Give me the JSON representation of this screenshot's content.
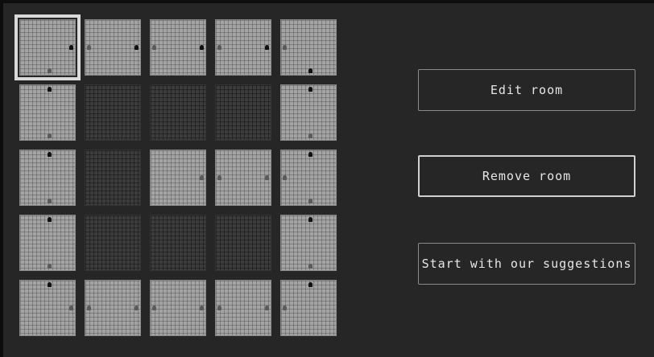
{
  "colors": {
    "background": "#262626",
    "room_floor": "#a3a3a3",
    "room_empty": "#3c3c3c",
    "selection": "#d9d9d9",
    "button_border": "#8a8a8a",
    "button_text": "#e6e6e6"
  },
  "map": {
    "rows": 5,
    "cols": 5,
    "selected": "0,0",
    "rooms": [
      [
        {
          "filled": true,
          "doors": {
            "bottom": "grey",
            "right": "dark"
          }
        },
        {
          "filled": true,
          "doors": {
            "left": "grey",
            "right": "dark"
          }
        },
        {
          "filled": true,
          "doors": {
            "left": "grey",
            "right": "dark"
          }
        },
        {
          "filled": true,
          "doors": {
            "left": "grey",
            "right": "dark"
          }
        },
        {
          "filled": true,
          "doors": {
            "left": "grey",
            "bottom": "dark"
          }
        }
      ],
      [
        {
          "filled": true,
          "doors": {
            "top": "dark",
            "bottom": "grey"
          }
        },
        {
          "filled": false,
          "doors": {}
        },
        {
          "filled": false,
          "doors": {}
        },
        {
          "filled": false,
          "doors": {}
        },
        {
          "filled": true,
          "doors": {
            "top": "dark",
            "bottom": "grey"
          }
        }
      ],
      [
        {
          "filled": true,
          "doors": {
            "top": "dark",
            "bottom": "grey"
          }
        },
        {
          "filled": false,
          "doors": {}
        },
        {
          "filled": true,
          "doors": {
            "right": "grey"
          }
        },
        {
          "filled": true,
          "doors": {
            "left": "grey",
            "right": "grey"
          }
        },
        {
          "filled": true,
          "doors": {
            "left": "grey",
            "top": "dark",
            "bottom": "grey"
          }
        }
      ],
      [
        {
          "filled": true,
          "doors": {
            "top": "dark",
            "bottom": "grey"
          }
        },
        {
          "filled": false,
          "doors": {}
        },
        {
          "filled": false,
          "doors": {}
        },
        {
          "filled": false,
          "doors": {}
        },
        {
          "filled": true,
          "doors": {
            "top": "dark",
            "bottom": "grey"
          }
        }
      ],
      [
        {
          "filled": true,
          "doors": {
            "top": "dark",
            "right": "grey"
          }
        },
        {
          "filled": true,
          "doors": {
            "left": "grey",
            "right": "grey"
          }
        },
        {
          "filled": true,
          "doors": {
            "left": "grey",
            "right": "grey"
          }
        },
        {
          "filled": true,
          "doors": {
            "left": "grey",
            "right": "grey"
          }
        },
        {
          "filled": true,
          "doors": {
            "left": "grey",
            "top": "dark"
          }
        }
      ]
    ]
  },
  "actions": {
    "edit_label": "Edit room",
    "remove_label": "Remove room",
    "suggest_label": "Start with our suggestions"
  }
}
